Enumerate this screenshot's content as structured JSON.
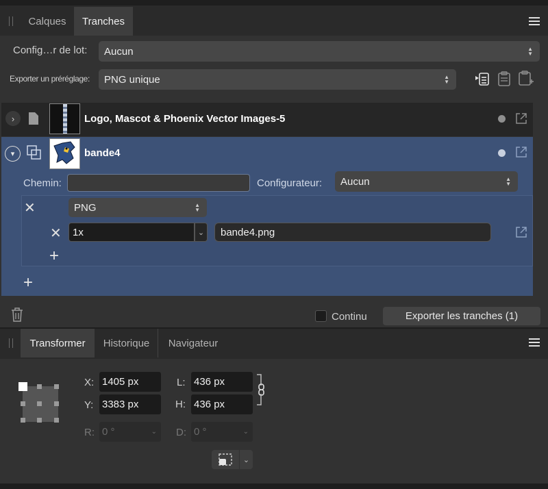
{
  "slices_panel": {
    "tabs": [
      {
        "label": "Calques",
        "active": false
      },
      {
        "label": "Tranches",
        "active": true
      }
    ],
    "batch_config": {
      "label": "Config…r de lot:",
      "value": "Aucun"
    },
    "export_preset": {
      "label": "Exporter un préréglage:",
      "value": "PNG unique"
    },
    "slices": [
      {
        "name": "Logo, Mascot & Phoenix Vector Images-5",
        "expanded": false,
        "selected": false
      },
      {
        "name": "bande4",
        "expanded": true,
        "selected": true
      }
    ],
    "detail": {
      "path_label": "Chemin:",
      "path_value": "",
      "configurator_label": "Configurateur:",
      "configurator_value": "Aucun",
      "format": "PNG",
      "scale": "1x",
      "filename": "bande4.png"
    },
    "footer": {
      "continuous_label": "Continu",
      "continuous_checked": false,
      "export_button": "Exporter les tranches (1)"
    }
  },
  "transform_panel": {
    "tabs": [
      {
        "label": "Transformer",
        "active": true
      },
      {
        "label": "Historique",
        "active": false
      },
      {
        "label": "Navigateur",
        "active": false
      }
    ],
    "x_label": "X:",
    "x_value": "1405 px",
    "y_label": "Y:",
    "y_value": "3383 px",
    "w_label": "L:",
    "w_value": "436 px",
    "h_label": "H:",
    "h_value": "436 px",
    "r_label": "R:",
    "r_value": "0 °",
    "s_label": "D:",
    "s_value": "0 °"
  },
  "colors": {
    "selected_row": "#3d5277",
    "panel_bg": "#323232",
    "field_bg": "#1c1c1c"
  }
}
